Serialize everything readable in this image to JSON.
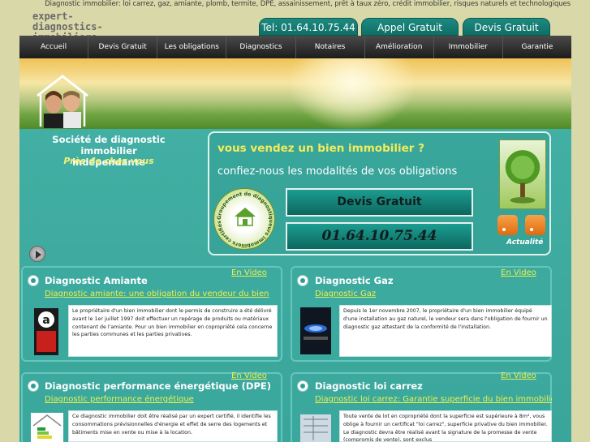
{
  "seo_topline": "Diagnostic immobilier: loi carrez, gaz, amiante, plomb, termite, DPE, assainissement, prêt à taux zéro, crédit immobilier, risques naturels et technologiques",
  "logo": {
    "line1": "expert-diagnostics-",
    "line2": "immobiliers."
  },
  "top_buttons": {
    "phone": "Tel: 01.64.10.75.44",
    "appel": "Appel Gratuit",
    "devis": "Devis Gratuit"
  },
  "nav": [
    "Accueil",
    "Devis Gratuit",
    "Les obligations",
    "Diagnostics",
    "Notaires",
    "Amélioration",
    "Immobilier",
    "Garantie"
  ],
  "tagline": {
    "line1": "Société de diagnostic immobilier",
    "line2": "indépendante",
    "line3": "Près de chez vous"
  },
  "promo": {
    "question": "vous vendez un bien immobilier ?",
    "subtitle": "confiez-nous les modalités de vos obligations",
    "devis_button": "Devis Gratuit",
    "phone": "01.64.10.75.44",
    "seal_text": "Groupement de diagnostiqueurs immobiliers certifiés",
    "news_label": "Actualité"
  },
  "cards": [
    {
      "title": "Diagnostic Amiante",
      "video": "En Video",
      "link": "Diagnostic amiante: une obligation du vendeur du bien",
      "text": "Le propriétaire d'un bien immobilier dont le permis de construire a été délivré avant le 1er juillet 1997 doit effectuer un repérage de produits ou matériaux contenant de l'amiante. Pour un bien immobilier en copropriété cela concerne les parties communes et les parties privatives."
    },
    {
      "title": "Diagnostic Gaz",
      "video": "En Video",
      "link": "Diagnostic Gaz",
      "text": "Depuis le 1er novembre 2007, le propriétaire d'un bien immobilier équipé d'une installation au gaz naturel, le vendeur sera dans l'obligation de fournir un diagnostic gaz attestant de la conformité de l'installation."
    },
    {
      "title": "Diagnostic performance énergétique (DPE)",
      "video": "En Video",
      "link": "Diagnostic performance énergétique",
      "text": "Ce diagnostic immobilier doit être réalisé par un expert certifié, il identifie les consommations prévisionnelles d'énergie et effet de serre des logements et bâtiments mise en vente ou mise à la location."
    },
    {
      "title": "Diagnostic loi carrez",
      "video": "En Video",
      "link": "Diagnostic loi carrez: Garantie superficie du bien immobilier",
      "text": "Toute vente de lot en copropriété dont la superficie est supérieure à 8m², vous oblige à fournir un certificat \"loi carrez\", superficie privative du bien immobilier. Le diagnostic devra être réalisé avant la signature de la promesse de vente (compromis de vente), sont exclus"
    }
  ]
}
